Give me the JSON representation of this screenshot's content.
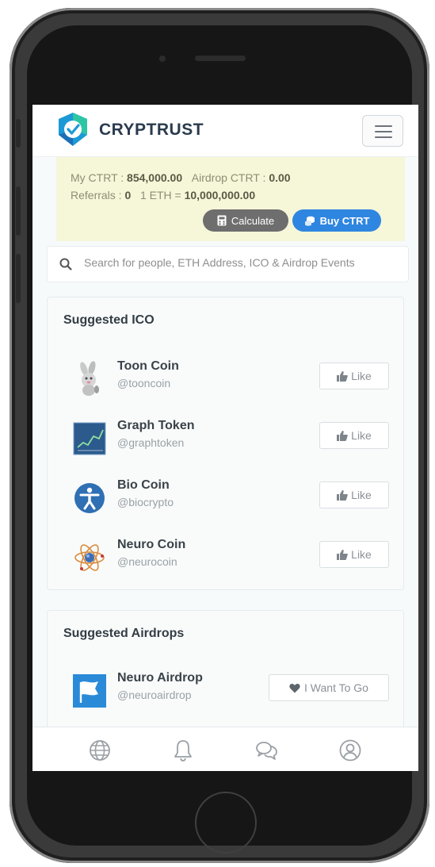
{
  "header": {
    "brand": "CRYPTRUST",
    "brand_color": "#2a3b4e",
    "logo_colors": [
      "#2ec5a5",
      "#1b9ad6",
      "#1d6fb8"
    ]
  },
  "balance": {
    "my_ctrt_label": "My CTRT : ",
    "my_ctrt_value": "854,000.00",
    "airdrop_label": "Airdrop CTRT : ",
    "airdrop_value": "0.00",
    "referrals_label": "Referrals : ",
    "referrals_value": "0",
    "eth_label": "1 ETH = ",
    "eth_value": "10,000,000.00",
    "calculate_label": "Calculate",
    "buy_label": "Buy CTRT"
  },
  "search": {
    "placeholder": "Search for people, ETH Address, ICO & Airdrop Events"
  },
  "suggested_ico": {
    "title": "Suggested ICO",
    "like_label": "Like",
    "items": [
      {
        "name": "Toon Coin",
        "handle": "@tooncoin",
        "icon": "bunny-icon"
      },
      {
        "name": "Graph Token",
        "handle": "@graphtoken",
        "icon": "graph-icon"
      },
      {
        "name": "Bio Coin",
        "handle": "@biocrypto",
        "icon": "person-icon"
      },
      {
        "name": "Neuro Coin",
        "handle": "@neurocoin",
        "icon": "atom-icon"
      }
    ]
  },
  "suggested_airdrops": {
    "title": "Suggested Airdrops",
    "items": [
      {
        "name": "Neuro Airdrop",
        "handle": "@neuroairdrop",
        "icon": "flag-icon",
        "action_label": "I Want To Go"
      }
    ]
  },
  "bottom_nav": [
    "globe-icon",
    "bell-icon",
    "chat-icon",
    "user-icon"
  ],
  "colors": {
    "accent_blue": "#2f86e0",
    "balance_bg": "#f6f6d9",
    "calc_button": "#6e6e6e"
  }
}
